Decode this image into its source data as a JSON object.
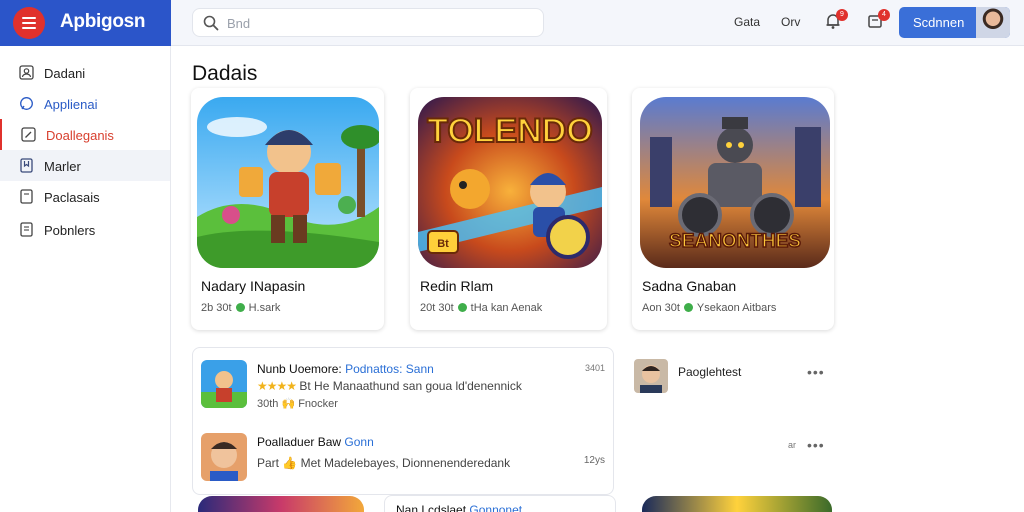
{
  "app": {
    "name": "Apbigosn"
  },
  "search": {
    "placeholder": "Bnd"
  },
  "topbar": {
    "links": [
      "Gata",
      "Orv"
    ],
    "badges": [
      "9",
      "4"
    ],
    "signin_label": "Scdnnen"
  },
  "sidebar": {
    "items": [
      {
        "label": "Dadani",
        "icon": "account-icon"
      },
      {
        "label": "Applienai",
        "icon": "apps-icon"
      },
      {
        "label": "Doalleganis",
        "icon": "edit-icon"
      },
      {
        "label": "Marler",
        "icon": "bookmark-icon"
      },
      {
        "label": "Paclasais",
        "icon": "document-icon"
      },
      {
        "label": "Pobnlers",
        "icon": "list-icon"
      }
    ]
  },
  "main": {
    "title": "Dadais",
    "cards": [
      {
        "title": "Nadary INapasin",
        "meta_left": "2b 30t",
        "meta_right": "H.sark",
        "art_text": ""
      },
      {
        "title": "Redin Rlam",
        "meta_left": "20t 30t",
        "meta_right": "tHa kan Aenak",
        "art_text": "TOLENDO",
        "badge_text": "Bt"
      },
      {
        "title": "Sadna Gnaban",
        "meta_left": "Aon 30t",
        "meta_right": "Ysekaon Aitbars",
        "art_text": "SEANONTHES"
      }
    ],
    "list": [
      {
        "title": "Nunb Uoemore:",
        "title_tag": "Podnattos: Sann",
        "stars": "★★★★",
        "subtitle": "Bt He Manaathund san goua ld'denennick",
        "meta": "30th 🙌 Fnocker",
        "time": "3401"
      },
      {
        "title": "Poalladuer Baw",
        "title_tag": "Gonn",
        "subtitle": "Part 👍 Met Madelebayes, Dionnenenderedank",
        "time": "12ys"
      }
    ],
    "side_entries": [
      {
        "name": "Paoglehtest",
        "more": "•••"
      },
      {
        "name": "",
        "time": "ar",
        "more": "•••"
      }
    ],
    "peek": {
      "title": "Nan Lcdslaet",
      "tag": "Gonnonet"
    }
  },
  "colors": {
    "brand": "#2b55c9",
    "accent_red": "#e0312c",
    "signin": "#3a6fd8",
    "link_blue": "#2a6fd6",
    "star": "#f1b31c",
    "rating_green": "#3fae4a"
  }
}
